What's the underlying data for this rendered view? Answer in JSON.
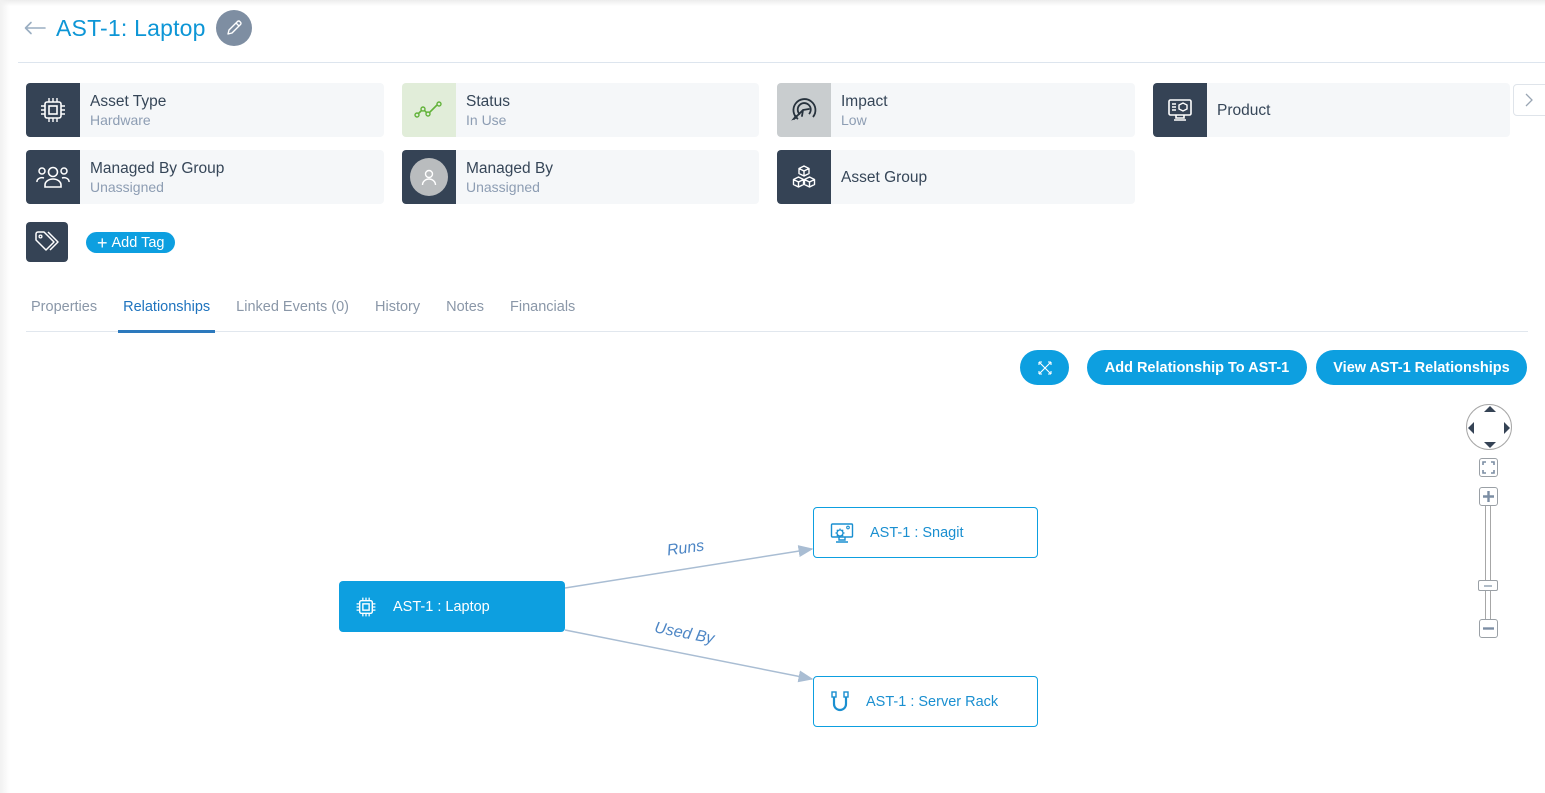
{
  "header": {
    "back_icon": "arrow-left-icon",
    "title": "AST-1: Laptop",
    "edit_icon": "pencil-icon"
  },
  "cards": [
    {
      "label": "Asset Type",
      "value": "Hardware",
      "icon": "cpu-chip-icon"
    },
    {
      "label": "Status",
      "value": "In Use",
      "icon": "trend-line-icon"
    },
    {
      "label": "Impact",
      "value": "Low",
      "icon": "target-cursor-icon"
    },
    {
      "label": "Product",
      "value": "",
      "icon": "monitor-box-icon"
    },
    {
      "label": "Managed By Group",
      "value": "Unassigned",
      "icon": "users-group-icon"
    },
    {
      "label": "Managed By",
      "value": "Unassigned",
      "icon": "user-avatar-icon"
    },
    {
      "label": "Asset Group",
      "value": "",
      "icon": "boxes-stack-icon"
    }
  ],
  "tags": {
    "icon": "tags-icon",
    "add_label": "Add Tag"
  },
  "tabs": [
    {
      "label": "Properties",
      "active": false
    },
    {
      "label": "Relationships",
      "active": true
    },
    {
      "label": "Linked Events (0)",
      "active": false
    },
    {
      "label": "History",
      "active": false
    },
    {
      "label": "Notes",
      "active": false
    },
    {
      "label": "Financials",
      "active": false
    }
  ],
  "actions": {
    "expand_icon": "expand-arrows-icon",
    "add_relationship": "Add Relationship To AST-1",
    "view_relationships": "View AST-1 Relationships"
  },
  "graph": {
    "nodes": [
      {
        "id": "laptop",
        "label": "AST-1 : Laptop",
        "icon": "cpu-chip-icon",
        "primary": true
      },
      {
        "id": "snagit",
        "label": "AST-1 : Snagit",
        "icon": "monitor-gear-icon",
        "primary": false
      },
      {
        "id": "rack",
        "label": "AST-1 : Server Rack",
        "icon": "cable-icon",
        "primary": false
      }
    ],
    "edges": [
      {
        "from": "laptop",
        "to": "snagit",
        "label": "Runs"
      },
      {
        "from": "laptop",
        "to": "rack",
        "label": "Used By"
      }
    ]
  },
  "colors": {
    "accent": "#0d9fe0",
    "title": "#0d96d6",
    "dark_icon_bg": "#354355",
    "edge": "#a9bdd3",
    "edge_label": "#4d86c5"
  }
}
